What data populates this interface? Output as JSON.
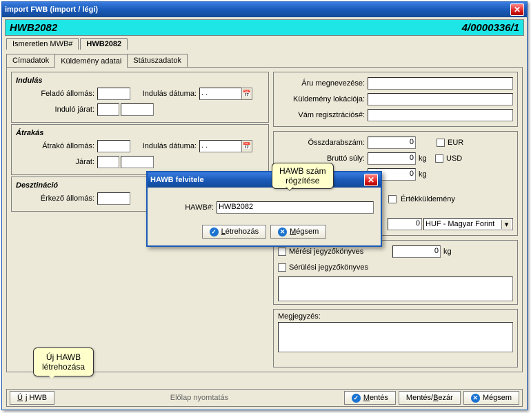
{
  "window": {
    "title": "import FWB (import / légi)"
  },
  "header": {
    "hwb": "HWB2082",
    "code": "4/0000336/1"
  },
  "main_tabs": {
    "unknown_mwb": "Ismeretlen MWB#",
    "hwb": "HWB2082"
  },
  "sub_tabs": {
    "cim": "Címadatok",
    "kuld": "Küldemény adatai",
    "stat": "Státuszadatok"
  },
  "left": {
    "indulas": {
      "title": "Indulás",
      "felado_label": "Feladó állomás:",
      "felado_val": "",
      "ind_datum_label": "Indulás dátuma:",
      "ind_datum_val": "  .  .",
      "indulo_label": "Induló járat:",
      "indulo_val": "",
      "indulo_val2": ""
    },
    "atrakas": {
      "title": "Átrakás",
      "atrako_label": "Átrakó állomás:",
      "atrako_val": "",
      "ind_datum_label": "Indulás dátuma:",
      "ind_datum_val": "  .  .",
      "jarat_label": "Járat:",
      "jarat_val": "",
      "jarat_val2": ""
    },
    "deszt": {
      "title": "Desztináció",
      "erkezo_label": "Érkező állomás:",
      "erkezo_val": ""
    }
  },
  "right": {
    "aru_label": "Áru megnevezése:",
    "aru_val": "",
    "lok_label": "Küldemény lokációja:",
    "lok_val": "",
    "vam_label": "Vám regisztrációs#:",
    "vam_val": "",
    "osszdarab_label": "Összdarabszám:",
    "osszdarab_val": "0",
    "brutto_label": "Bruttó súly:",
    "brutto_val": "0",
    "kg": "kg",
    "row3_val": "0",
    "row3_kg": "kg",
    "eur": "EUR",
    "usd": "USD",
    "ertek": "Értékküldemény",
    "currency_val": "0",
    "currency_sel": "HUF - Magyar Forint",
    "meresi": "Mérési jegyzőkönyves",
    "meresi_val": "0",
    "meresi_kg": "kg",
    "serulesi": "Sérülési jegyzőkönyves",
    "megjegyzes": "Megjegyzés:"
  },
  "bottom": {
    "uj_hwb": "Új HWB",
    "elolap": "Előlap nyomtatás",
    "mentes": "Mentés",
    "mentes_bezar": "Mentés/Bezár",
    "megsem": "Mégsem"
  },
  "dialog": {
    "title": "HAWB felvitele",
    "hawb_label": "HAWB#:",
    "hawb_val": "HWB2082",
    "letrehozas": "Létrehozás",
    "megsem": "Mégsem"
  },
  "balloons": {
    "uj_l1": "Új HAWB",
    "uj_l2": "létrehozása",
    "rogzites_l1": "HAWB szám",
    "rogzites_l2": "rögzítése"
  }
}
